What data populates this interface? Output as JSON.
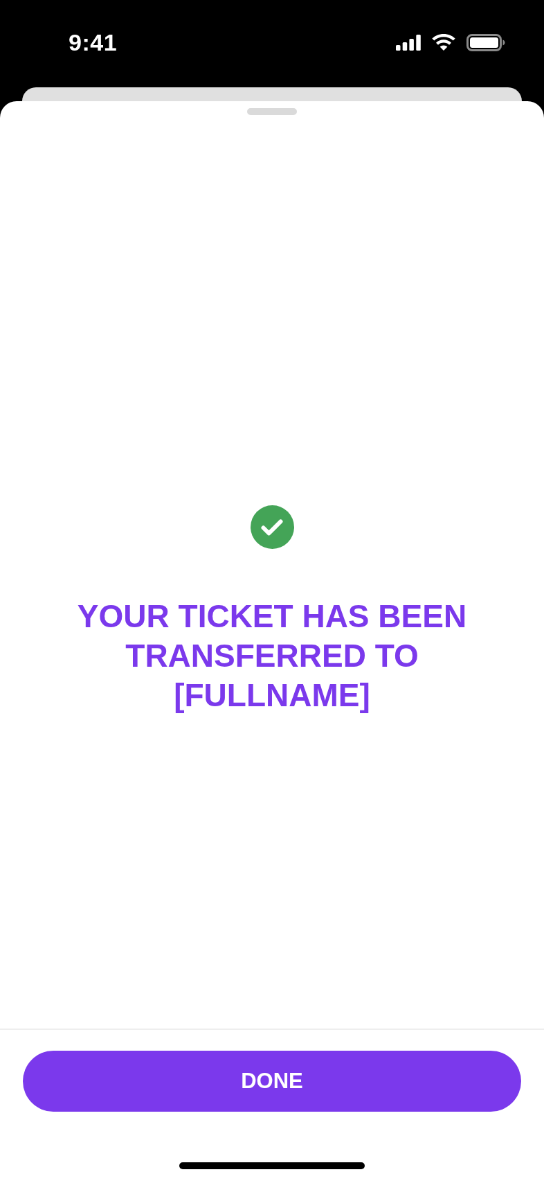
{
  "status_bar": {
    "time": "9:41"
  },
  "confirmation": {
    "message": "YOUR TICKET HAS BEEN TRANSFERRED TO [FULLNAME]"
  },
  "footer": {
    "button": "DONE"
  }
}
